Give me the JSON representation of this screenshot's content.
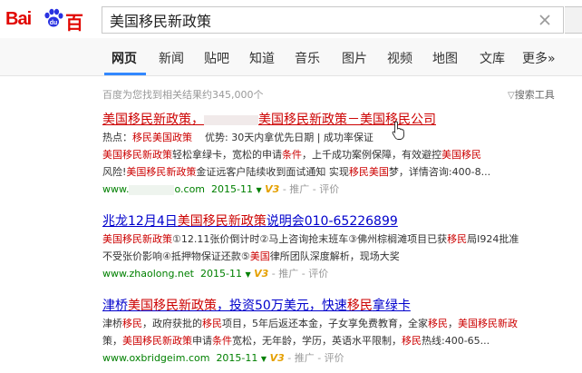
{
  "logo": {
    "part1": "Bai",
    "part2": "百度"
  },
  "search": {
    "query": "美国移民新政策"
  },
  "tabs": [
    "网页",
    "新闻",
    "贴吧",
    "知道",
    "音乐",
    "图片",
    "视频",
    "地图",
    "文库",
    "更多»"
  ],
  "stats": "百度为您找到相关结果约345,000个",
  "tools": "搜索工具",
  "results": [
    {
      "title_a": "美国移民新政策，",
      "title_b": "美国移民新政策－美国移民公司",
      "hot_prefix": "热点：",
      "hot_link": "移民美国政策",
      "hot_rest": "优势: 30天内拿优先日期 | 成功率保证",
      "line1_hl": "美国移民新政策",
      "line1_rest": "轻松拿绿卡，宽松的申请",
      "line1_hl2": "条件",
      "line1_rest2": "，上千成功案例保障，有效避控",
      "line1_hl3": "美国移民",
      "line2_a": "风险!",
      "line2_hl": "美国移民新政策",
      "line2_b": "金证远客户陆续收到面试通知 实现",
      "line2_hl2": "移民美国",
      "line2_c": "梦，详情咨询:400-8...",
      "url": "www.",
      "url2": "o.com",
      "date": "2015-11",
      "v3": "V3",
      "extra": "- 推广 - 评价"
    },
    {
      "title_a": "兆龙12月4日",
      "title_hl": "美国移民新政策",
      "title_b": "说明会010-65226899",
      "line1_hl": "美国移民新政策",
      "line1_rest": "①12.11张价倒计时②马上咨询抢末班车③佛州棕榈滩项目已获",
      "line1_hl2": "移民",
      "line1_rest2": "局I924批准",
      "line2_a": "不受张价影响④抵押物保证还款⑤",
      "line2_hl": "美国",
      "line2_b": "律所团队深度解析，现场大奖",
      "url": "www.zhaolong.net",
      "date": "2015-11",
      "v3": "V3",
      "extra": "- 推广 - 评价"
    },
    {
      "title_a": "津桥",
      "title_hl": "美国移民新政策",
      "title_b": "，投资50万美元，快速",
      "title_hl2": "移民",
      "title_c": "拿绿卡",
      "line1_a": "津桥",
      "line1_hl": "移民",
      "line1_b": "，政府获批的",
      "line1_hl2": "移民",
      "line1_c": "项目，5年后返还本金，子女享免费教育，全家",
      "line1_hl3": "移民",
      "line1_d": "，",
      "line1_hl4": "美国移民新政",
      "line2_a": "策，",
      "line2_hl": "美国移民新政策",
      "line2_b": "申请",
      "line2_hl2": "条件",
      "line2_c": "宽松，无年龄，学历，英语水平限制，",
      "line2_hl3": "移民",
      "line2_d": "热线:400-65...",
      "url": "www.oxbridgeim.com",
      "date": "2015-11",
      "v3": "V3",
      "extra": "- 推广 - 评价"
    }
  ]
}
